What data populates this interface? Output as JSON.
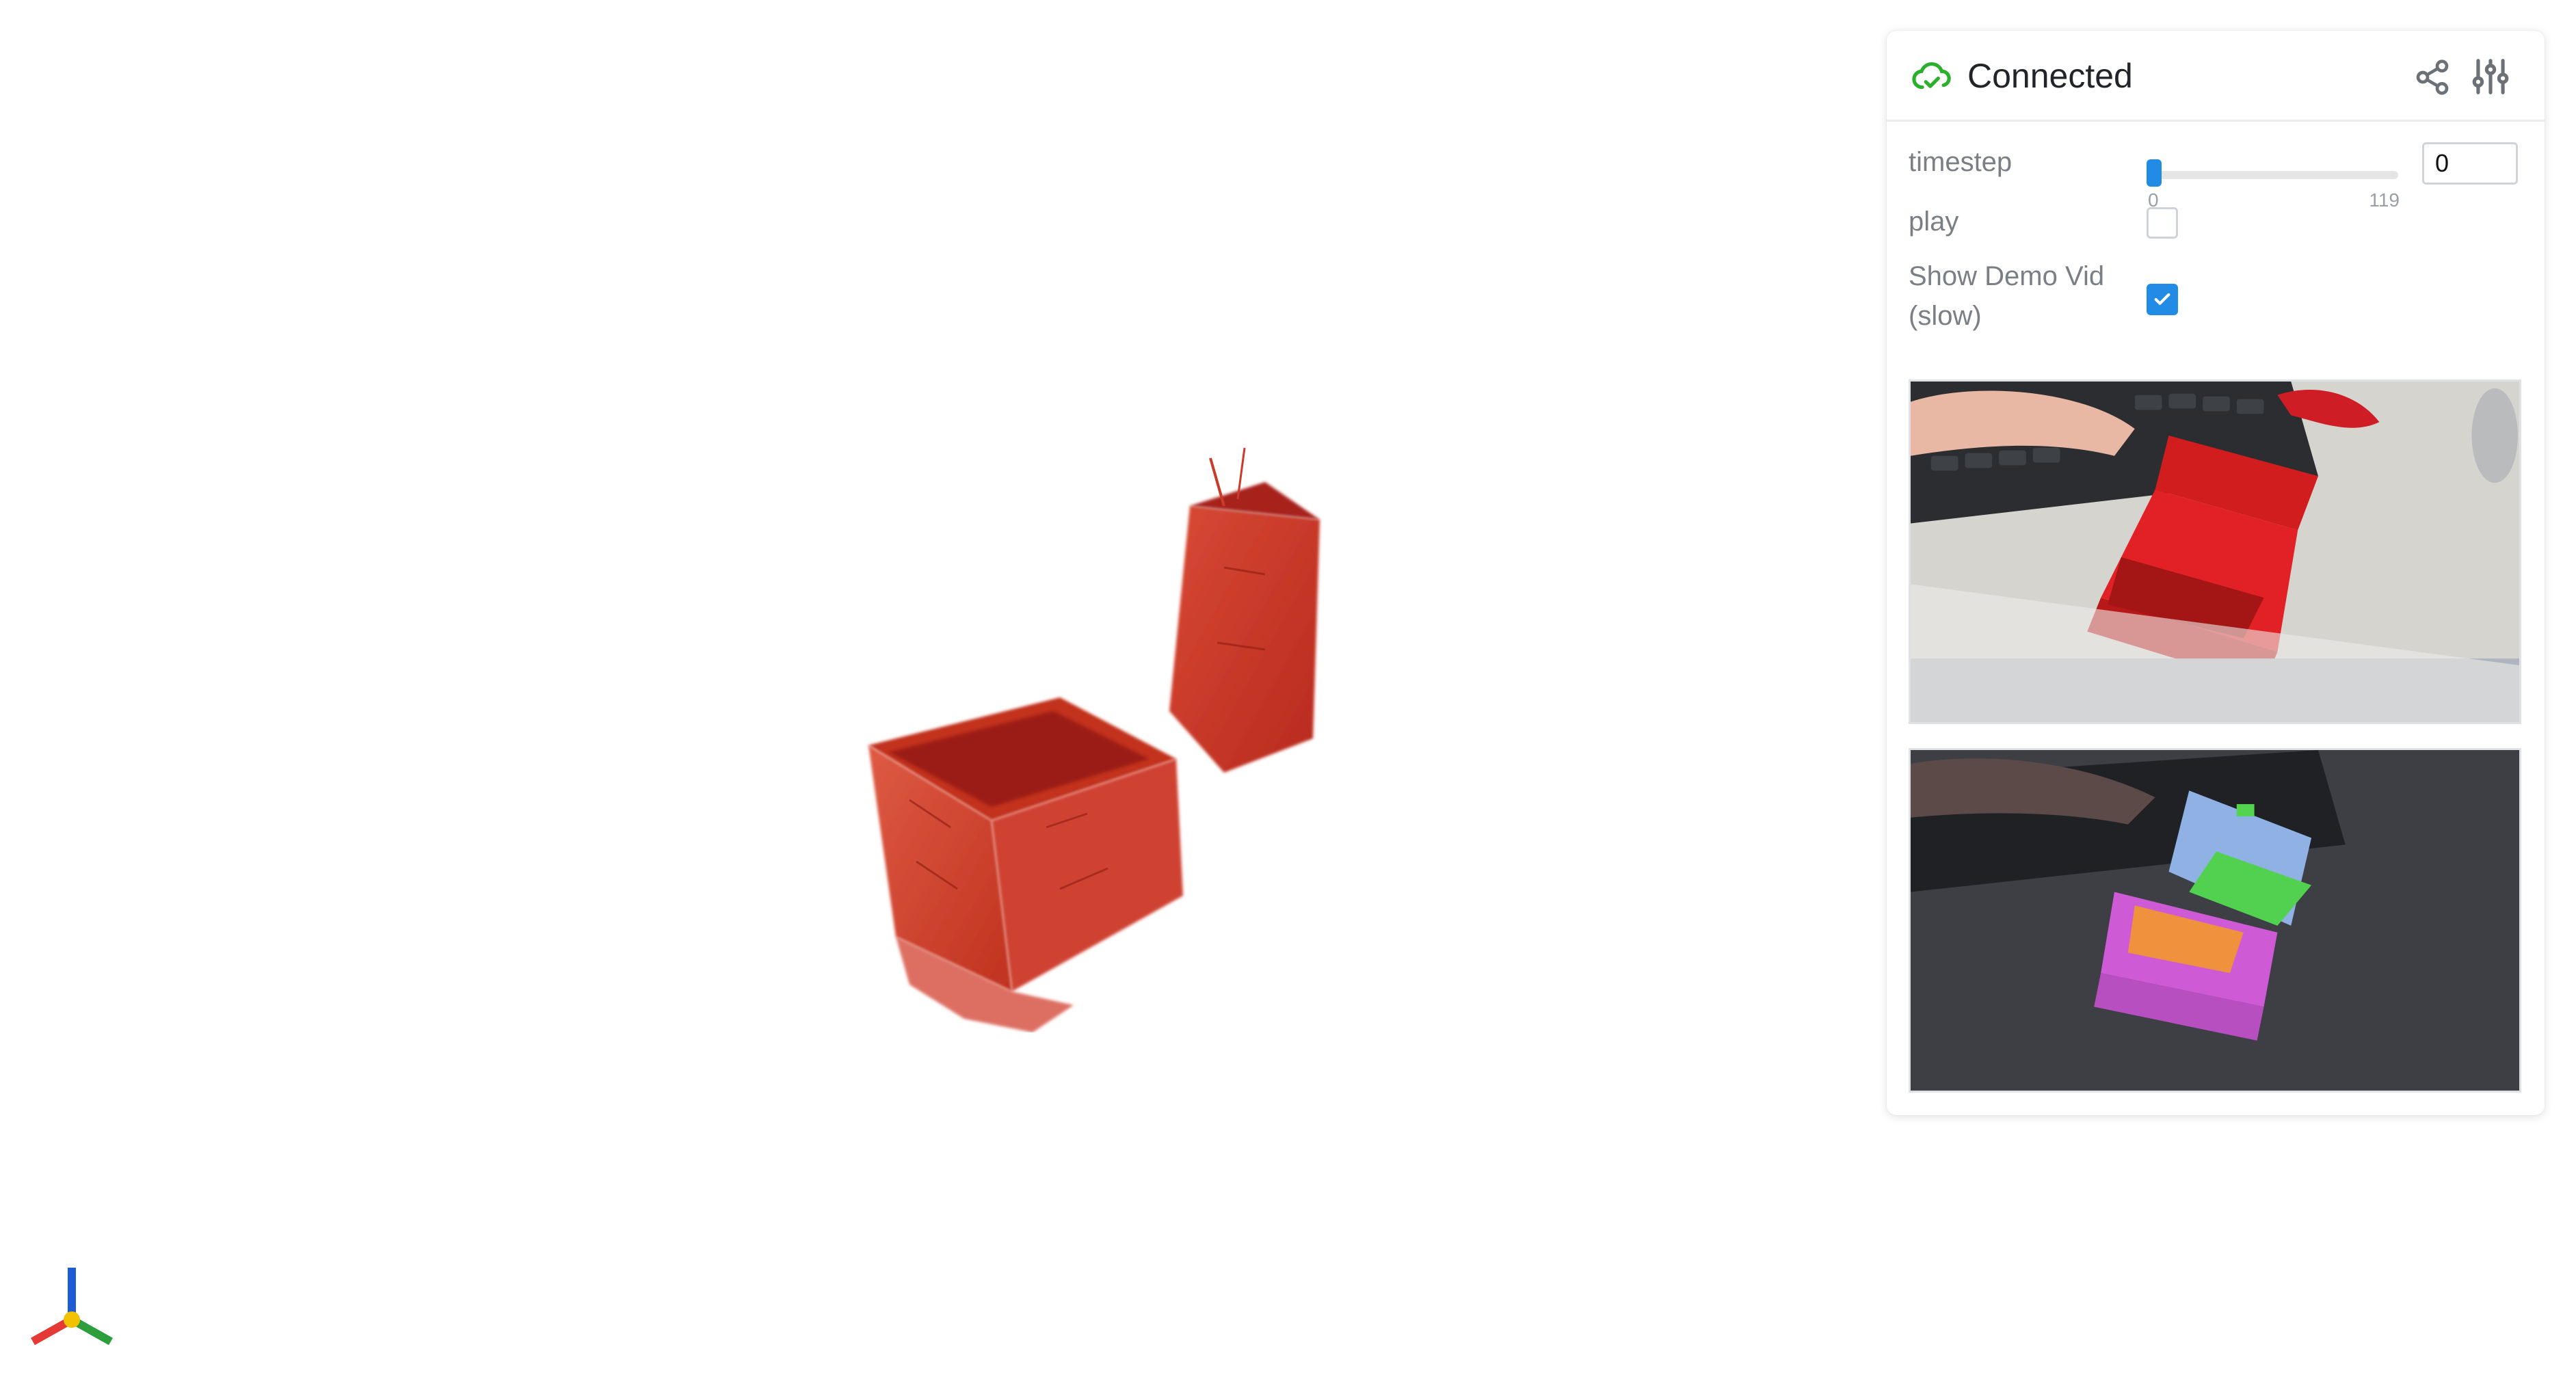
{
  "app": {
    "status": "Connected",
    "status_color": "#2bb02b",
    "accent_color": "#228be6"
  },
  "panel": {
    "header_icons": [
      "cloud-check-icon",
      "share-icon",
      "settings-sliders-icon"
    ],
    "controls": {
      "timestep": {
        "label": "timestep",
        "value": "0",
        "min": "0",
        "max": "119",
        "fraction": 0.0
      },
      "play": {
        "label": "play",
        "checked": false
      },
      "show_demo": {
        "label": "Show Demo Vid (slow)",
        "checked": true
      }
    },
    "videos": [
      "rgb-demo-frame",
      "segmentation-overlay-frame"
    ]
  },
  "viewport": {
    "object": "red-box-3d-render",
    "axes_colors": {
      "x": "#e53935",
      "y": "#2e9e3c",
      "z": "#1e5bd6",
      "origin": "#f2c200"
    }
  }
}
